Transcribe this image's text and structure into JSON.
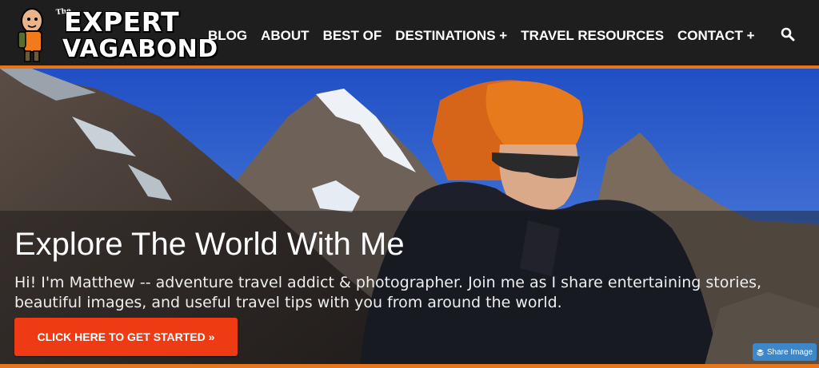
{
  "brand": {
    "small": "The",
    "word1": "EXPERT",
    "word2": "VAGABOND"
  },
  "nav": {
    "items": [
      {
        "label": "BLOG"
      },
      {
        "label": "ABOUT"
      },
      {
        "label": "BEST OF"
      },
      {
        "label": "DESTINATIONS +"
      },
      {
        "label": "TRAVEL RESOURCES"
      },
      {
        "label": "CONTACT +"
      }
    ],
    "search_icon": "search-icon"
  },
  "hero": {
    "title": "Explore The World With Me",
    "text": "Hi! I'm Matthew -- adventure travel addict & photographer. Join me as I share entertaining stories, beautiful images, and useful travel tips with you from around the world.",
    "cta_label": "CLICK HERE TO GET STARTED »",
    "share_label": "Share Image"
  },
  "colors": {
    "accent": "#e8751a",
    "cta": "#ee3b14",
    "share": "#3d86c8",
    "header_bg": "#1e1e1e"
  }
}
